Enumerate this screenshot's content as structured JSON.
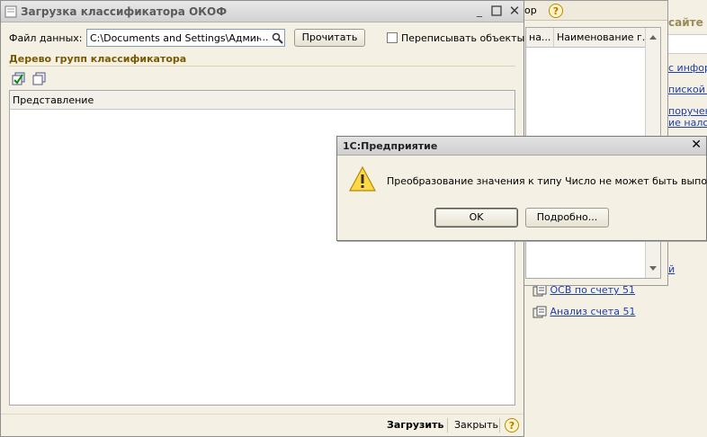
{
  "background_window": {
    "toolbar_text": "ор",
    "columns": [
      "на...",
      "Наименование г..."
    ]
  },
  "right_panel": {
    "header_text": "сайте И",
    "links": [
      "с информ",
      "пиской о",
      "поручен",
      "ие налог"
    ],
    "bottom_links": [
      "ОСВ по счету 51",
      "Анализ счета 51"
    ],
    "stray_link": "й"
  },
  "main_window": {
    "title": "Загрузка классификатора ОКОФ",
    "file_label": "Файл данных:",
    "file_value": "C:\\Documents and Settings\\Админист",
    "file_ellipsis": "...",
    "read_button": "Прочитать",
    "overwrite_label": "Переписывать объекты",
    "tree_title": "Дерево групп классификатора",
    "tree_column": "Представление",
    "load_button": "Загрузить",
    "close_button": "Закрыть"
  },
  "dialog": {
    "title": "1С:Предприятие",
    "message": "Преобразование значения к типу Число не может быть выполнено",
    "ok_button": "OK",
    "details_button": "Подробно..."
  },
  "colors": {
    "window_bg": "#f4f1e4",
    "section_title": "#7a5a00",
    "link": "#1d3da8",
    "help_icon": "#e0a000"
  }
}
